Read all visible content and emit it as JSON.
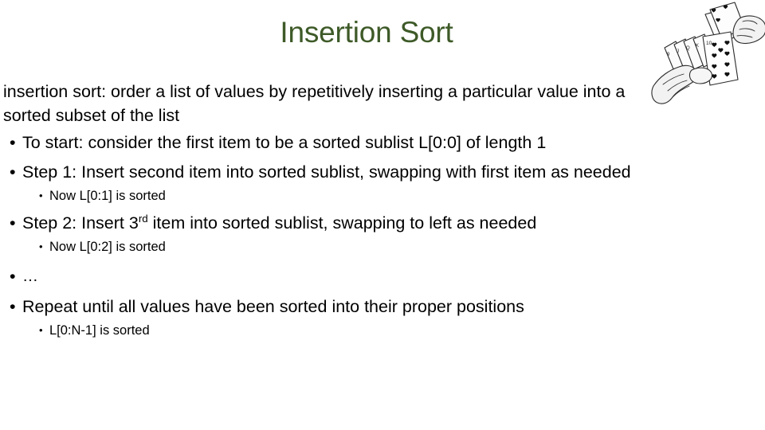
{
  "slide": {
    "title": "Insertion Sort",
    "title_color": "#3E5A28",
    "background_color": "#FFFFFF",
    "text_color": "#000000",
    "definition_line_1": "insertion sort: order a list of values by repetitively inserting a particular",
    "definition_line_2": "value into a sorted subset of the list",
    "bullets": [
      {
        "marker": "•",
        "text": "To start: consider the first item to be a sorted sublist L[0:0] of length 1",
        "sub": []
      },
      {
        "marker": "•",
        "text": "Step 1: Insert second item into sorted sublist, swapping with first item as needed",
        "sub": [
          {
            "marker": "•",
            "text": "Now L[0:1] is sorted"
          }
        ]
      },
      {
        "marker": "•",
        "text_before_sup": "Step 2: Insert 3",
        "sup": "rd",
        "text_after_sup": " item into sorted sublist, swapping to left as needed",
        "sub": [
          {
            "marker": "•",
            "text": "Now L[0:2] is sorted"
          }
        ]
      },
      {
        "marker": "•",
        "text": "…",
        "sub": []
      },
      {
        "marker": "•",
        "text": "Repeat until all values have been sorted into their proper positions",
        "sub": [
          {
            "marker": "•",
            "text": "L[0:N-1] is sorted"
          }
        ]
      }
    ],
    "image": {
      "name": "playing-cards-in-hands-illustration",
      "description": "Line drawing of two hands holding a fan of playing cards showing heart suits"
    }
  }
}
